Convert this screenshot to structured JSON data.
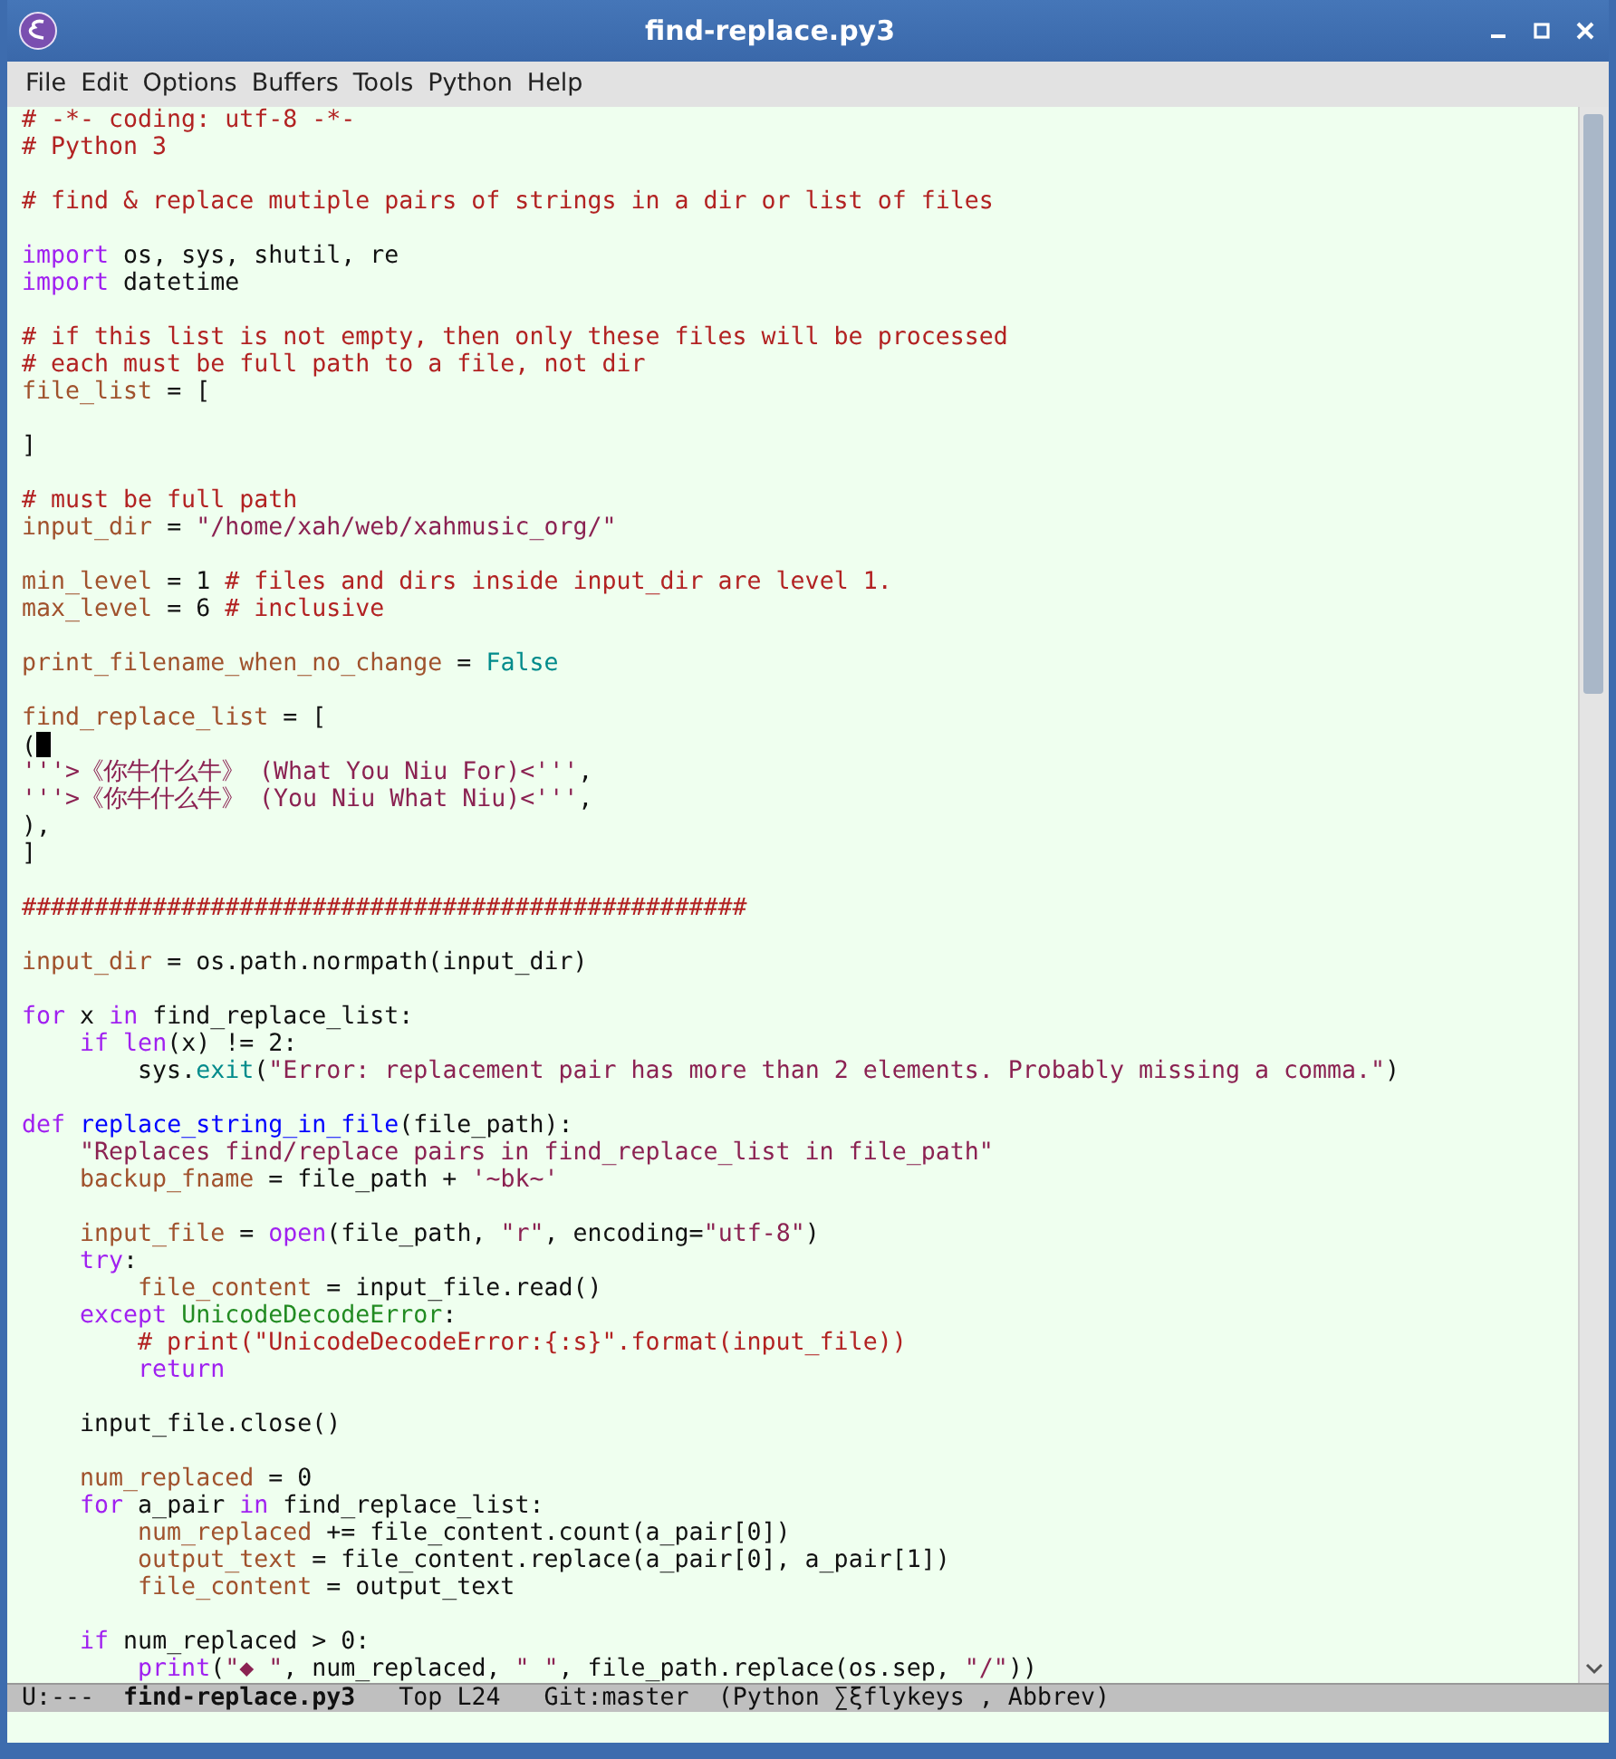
{
  "window": {
    "title": "find-replace.py3"
  },
  "menu": [
    "File",
    "Edit",
    "Options",
    "Buffers",
    "Tools",
    "Python",
    "Help"
  ],
  "lines": [
    {
      "kind": "code",
      "tokens": [
        {
          "text": "# -*- coding: utf-8 -*-",
          "kind": "comment"
        }
      ]
    },
    {
      "kind": "code",
      "tokens": [
        {
          "text": "# Python 3",
          "kind": "comment"
        }
      ]
    },
    {
      "kind": "blank"
    },
    {
      "kind": "code",
      "tokens": [
        {
          "text": "# find & replace mutiple pairs of strings in a dir or list of files",
          "kind": "comment"
        }
      ]
    },
    {
      "kind": "blank"
    },
    {
      "kind": "code",
      "tokens": [
        {
          "text": "import",
          "kind": "keyword"
        },
        {
          "text": " os, sys, shutil, re",
          "kind": "plain"
        }
      ]
    },
    {
      "kind": "code",
      "tokens": [
        {
          "text": "import",
          "kind": "keyword"
        },
        {
          "text": " datetime",
          "kind": "plain"
        }
      ]
    },
    {
      "kind": "blank"
    },
    {
      "kind": "code",
      "tokens": [
        {
          "text": "# if this list is not empty, then only these files will be processed",
          "kind": "comment"
        }
      ]
    },
    {
      "kind": "code",
      "tokens": [
        {
          "text": "# each must be full path to a file, not dir",
          "kind": "comment"
        }
      ]
    },
    {
      "kind": "code",
      "tokens": [
        {
          "text": "file_list",
          "kind": "variable"
        },
        {
          "text": " = [",
          "kind": "plain"
        }
      ]
    },
    {
      "kind": "blank"
    },
    {
      "kind": "code",
      "tokens": [
        {
          "text": "]",
          "kind": "plain"
        }
      ]
    },
    {
      "kind": "blank"
    },
    {
      "kind": "code",
      "tokens": [
        {
          "text": "# must be full path",
          "kind": "comment"
        }
      ]
    },
    {
      "kind": "code",
      "tokens": [
        {
          "text": "input_dir",
          "kind": "variable"
        },
        {
          "text": " = ",
          "kind": "plain"
        },
        {
          "text": "\"/home/xah/web/xahmusic_org/\"",
          "kind": "string"
        }
      ]
    },
    {
      "kind": "blank"
    },
    {
      "kind": "code",
      "tokens": [
        {
          "text": "min_level",
          "kind": "variable"
        },
        {
          "text": " = 1 ",
          "kind": "plain"
        },
        {
          "text": "# files and dirs inside input_dir are level 1.",
          "kind": "comment"
        }
      ]
    },
    {
      "kind": "code",
      "tokens": [
        {
          "text": "max_level",
          "kind": "variable"
        },
        {
          "text": " = 6 ",
          "kind": "plain"
        },
        {
          "text": "# inclusive",
          "kind": "comment"
        }
      ]
    },
    {
      "kind": "blank"
    },
    {
      "kind": "code",
      "tokens": [
        {
          "text": "print_filename_when_no_change",
          "kind": "variable"
        },
        {
          "text": " = ",
          "kind": "plain"
        },
        {
          "text": "False",
          "kind": "constant"
        }
      ]
    },
    {
      "kind": "blank"
    },
    {
      "kind": "code",
      "tokens": [
        {
          "text": "find_replace_list",
          "kind": "variable"
        },
        {
          "text": " = [",
          "kind": "plain"
        }
      ]
    },
    {
      "kind": "code",
      "tokens": [
        {
          "text": "(",
          "kind": "plain"
        },
        {
          "kind": "cursor"
        }
      ]
    },
    {
      "kind": "code",
      "tokens": [
        {
          "text": "'''>《你牛什么牛》 (What You Niu For)<'''",
          "kind": "string"
        },
        {
          "text": ",",
          "kind": "plain"
        }
      ]
    },
    {
      "kind": "code",
      "tokens": [
        {
          "text": "'''>《你牛什么牛》 (You Niu What Niu)<'''",
          "kind": "string"
        },
        {
          "text": ",",
          "kind": "plain"
        }
      ]
    },
    {
      "kind": "code",
      "tokens": [
        {
          "text": "),",
          "kind": "plain"
        }
      ]
    },
    {
      "kind": "code",
      "tokens": [
        {
          "text": "]",
          "kind": "plain"
        }
      ]
    },
    {
      "kind": "blank"
    },
    {
      "kind": "code",
      "tokens": [
        {
          "text": "##################################################",
          "kind": "comment"
        }
      ]
    },
    {
      "kind": "blank"
    },
    {
      "kind": "code",
      "tokens": [
        {
          "text": "input_dir",
          "kind": "variable"
        },
        {
          "text": " = os.path.normpath(input_dir)",
          "kind": "plain"
        }
      ]
    },
    {
      "kind": "blank"
    },
    {
      "kind": "code",
      "tokens": [
        {
          "text": "for",
          "kind": "keyword"
        },
        {
          "text": " x ",
          "kind": "plain"
        },
        {
          "text": "in",
          "kind": "keyword"
        },
        {
          "text": " find_replace_list:",
          "kind": "plain"
        }
      ]
    },
    {
      "kind": "code",
      "tokens": [
        {
          "text": "    if",
          "kind": "keyword"
        },
        {
          "text": " len",
          "kind": "builtin"
        },
        {
          "text": "(x) != 2:",
          "kind": "plain"
        }
      ]
    },
    {
      "kind": "code",
      "tokens": [
        {
          "text": "        sys.",
          "kind": "plain"
        },
        {
          "text": "exit",
          "kind": "method"
        },
        {
          "text": "(",
          "kind": "plain"
        },
        {
          "text": "\"Error: replacement pair has more than 2 elements. Probably missing a comma.\"",
          "kind": "string"
        },
        {
          "text": ")",
          "kind": "plain"
        }
      ]
    },
    {
      "kind": "blank"
    },
    {
      "kind": "code",
      "tokens": [
        {
          "text": "def",
          "kind": "keyword"
        },
        {
          "text": " replace_string_in_file",
          "kind": "function"
        },
        {
          "text": "(file_path):",
          "kind": "plain"
        }
      ]
    },
    {
      "kind": "code",
      "tokens": [
        {
          "text": "    \"Replaces find/replace pairs in find_replace_list in file_path\"",
          "kind": "string"
        }
      ]
    },
    {
      "kind": "code",
      "tokens": [
        {
          "text": "    backup_fname",
          "kind": "variable"
        },
        {
          "text": " = file_path + ",
          "kind": "plain"
        },
        {
          "text": "'~bk~'",
          "kind": "string"
        }
      ]
    },
    {
      "kind": "blank"
    },
    {
      "kind": "code",
      "tokens": [
        {
          "text": "    input_file",
          "kind": "variable"
        },
        {
          "text": " = ",
          "kind": "plain"
        },
        {
          "text": "open",
          "kind": "builtin"
        },
        {
          "text": "(file_path, ",
          "kind": "plain"
        },
        {
          "text": "\"r\"",
          "kind": "string"
        },
        {
          "text": ", encoding=",
          "kind": "plain"
        },
        {
          "text": "\"utf-8\"",
          "kind": "string"
        },
        {
          "text": ")",
          "kind": "plain"
        }
      ]
    },
    {
      "kind": "code",
      "tokens": [
        {
          "text": "    try",
          "kind": "keyword"
        },
        {
          "text": ":",
          "kind": "plain"
        }
      ]
    },
    {
      "kind": "code",
      "tokens": [
        {
          "text": "        file_content",
          "kind": "variable"
        },
        {
          "text": " = input_file.read()",
          "kind": "plain"
        }
      ]
    },
    {
      "kind": "code",
      "tokens": [
        {
          "text": "    except",
          "kind": "keyword"
        },
        {
          "text": " UnicodeDecodeError",
          "kind": "type"
        },
        {
          "text": ":",
          "kind": "plain"
        }
      ]
    },
    {
      "kind": "code",
      "tokens": [
        {
          "text": "        # print(\"UnicodeDecodeError:{:s}\".format(input_file))",
          "kind": "comment"
        }
      ]
    },
    {
      "kind": "code",
      "tokens": [
        {
          "text": "        return",
          "kind": "keyword"
        }
      ]
    },
    {
      "kind": "blank"
    },
    {
      "kind": "code",
      "tokens": [
        {
          "text": "    input_file.close()",
          "kind": "plain"
        }
      ]
    },
    {
      "kind": "blank"
    },
    {
      "kind": "code",
      "tokens": [
        {
          "text": "    num_replaced",
          "kind": "variable"
        },
        {
          "text": " = 0",
          "kind": "plain"
        }
      ]
    },
    {
      "kind": "code",
      "tokens": [
        {
          "text": "    for",
          "kind": "keyword"
        },
        {
          "text": " a_pair ",
          "kind": "plain"
        },
        {
          "text": "in",
          "kind": "keyword"
        },
        {
          "text": " find_replace_list:",
          "kind": "plain"
        }
      ]
    },
    {
      "kind": "code",
      "tokens": [
        {
          "text": "        num_replaced",
          "kind": "variable"
        },
        {
          "text": " += file_content.count(a_pair[0])",
          "kind": "plain"
        }
      ]
    },
    {
      "kind": "code",
      "tokens": [
        {
          "text": "        output_text",
          "kind": "variable"
        },
        {
          "text": " = file_content.replace(a_pair[0], a_pair[1])",
          "kind": "plain"
        }
      ]
    },
    {
      "kind": "code",
      "tokens": [
        {
          "text": "        file_content",
          "kind": "variable"
        },
        {
          "text": " = output_text",
          "kind": "plain"
        }
      ]
    },
    {
      "kind": "blank"
    },
    {
      "kind": "code",
      "tokens": [
        {
          "text": "    if",
          "kind": "keyword"
        },
        {
          "text": " num_replaced > 0:",
          "kind": "plain"
        }
      ]
    },
    {
      "kind": "code",
      "tokens": [
        {
          "text": "        print",
          "kind": "builtin"
        },
        {
          "text": "(",
          "kind": "plain"
        },
        {
          "text": "\"◆ \"",
          "kind": "string"
        },
        {
          "text": ", num_replaced, ",
          "kind": "plain"
        },
        {
          "text": "\" \"",
          "kind": "string"
        },
        {
          "text": ", file_path.replace(os.sep, ",
          "kind": "plain"
        },
        {
          "text": "\"/\"",
          "kind": "string"
        },
        {
          "text": "))",
          "kind": "plain"
        }
      ]
    }
  ],
  "mode_line": {
    "status": "U:---",
    "buffer": "find-replace.py3",
    "position": "Top L24",
    "vc": "Git:master",
    "modes": "(Python ∑ξflykeys , Abbrev)"
  }
}
